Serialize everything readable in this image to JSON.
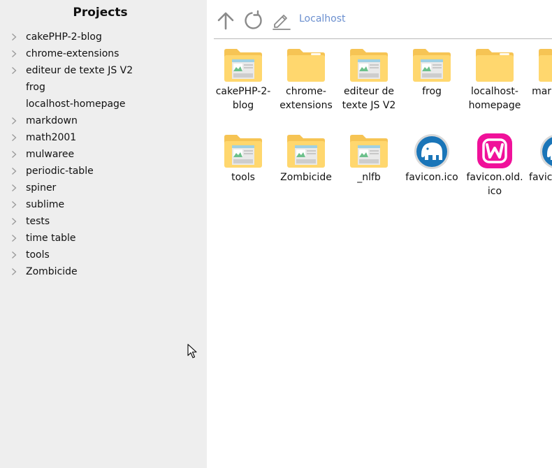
{
  "sidebar": {
    "title": "Projects",
    "items": [
      {
        "label": "cakePHP-2-blog",
        "expandable": true
      },
      {
        "label": "chrome-extensions",
        "expandable": true
      },
      {
        "label": "editeur de texte JS V2",
        "expandable": true
      },
      {
        "label": "frog",
        "expandable": false
      },
      {
        "label": "localhost-homepage",
        "expandable": false
      },
      {
        "label": "markdown",
        "expandable": true
      },
      {
        "label": "math2001",
        "expandable": true
      },
      {
        "label": "mulwaree",
        "expandable": true
      },
      {
        "label": "periodic-table",
        "expandable": true
      },
      {
        "label": "spiner",
        "expandable": true
      },
      {
        "label": "sublime",
        "expandable": true
      },
      {
        "label": "tests",
        "expandable": true
      },
      {
        "label": "time table",
        "expandable": true
      },
      {
        "label": "tools",
        "expandable": true
      },
      {
        "label": "Zombicide",
        "expandable": true
      }
    ]
  },
  "toolbar": {
    "up_icon": "arrow-up-icon",
    "refresh_icon": "refresh-icon",
    "edit_icon": "pencil-icon",
    "breadcrumb": "Localhost"
  },
  "files": [
    {
      "label": "cakePHP-2-blog",
      "icon": "folder-site-icon"
    },
    {
      "label": "chrome-extensions",
      "icon": "folder-icon"
    },
    {
      "label": "editeur de texte JS V2",
      "icon": "folder-site-icon"
    },
    {
      "label": "frog",
      "icon": "folder-site-icon"
    },
    {
      "label": "localhost-homepage",
      "icon": "folder-icon"
    },
    {
      "label": "markdown",
      "icon": "folder-icon"
    },
    {
      "label": "tools",
      "icon": "folder-site-icon"
    },
    {
      "label": "Zombicide",
      "icon": "folder-site-icon"
    },
    {
      "label": "_nlfb",
      "icon": "folder-site-icon"
    },
    {
      "label": "favicon.ico",
      "icon": "mamp-elephant-icon"
    },
    {
      "label": "favicon.old.ico",
      "icon": "wamp-logo-icon"
    },
    {
      "label": "favicon.png",
      "icon": "mamp-elephant-icon"
    }
  ],
  "colors": {
    "sidebar_bg": "#eeeeee",
    "folder": "#ffd76e",
    "folder_back": "#f6c454",
    "breadcrumb": "#6b8fcf",
    "elephant_blue": "#1a75b8",
    "wamp_pink": "#f0119a"
  }
}
